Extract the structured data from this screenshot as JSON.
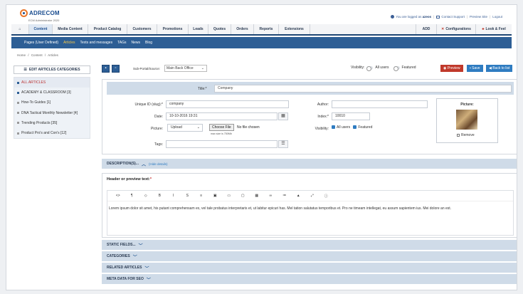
{
  "brand": {
    "name": "ADRECOM",
    "subtitle": "ECM Administrator 2020"
  },
  "top_links": {
    "logged_in_prefix": "You are logged as",
    "user": "azeos",
    "contact": "Contact Support",
    "preview_site": "Preview Site",
    "logout": "Logout"
  },
  "main_nav": {
    "home_icon": "home-icon",
    "tabs": [
      "Content",
      "Media Content",
      "Product Catalog",
      "Customers",
      "Promotions",
      "Leads",
      "Quotes",
      "Orders",
      "Reports",
      "Extensions"
    ],
    "active_tab": "Content",
    "right_tabs": [
      "ADD",
      "Configurations",
      "Look & Feel"
    ]
  },
  "sub_nav": {
    "items": [
      "Pages (User Defined)",
      "Articles",
      "Texts and messages",
      "TAGs",
      "News",
      "Blog"
    ],
    "active": "Articles"
  },
  "breadcrumb": [
    "Home",
    "/",
    "Content",
    "/",
    "Articles"
  ],
  "left_panel": {
    "edit_button": "EDIT ARTICLES CATEGORIES",
    "categories": [
      "ALL ARTICLES",
      "ACADEMY & CLASSROOM [3]",
      "How-To Guides [1]",
      "DNA Tactical Monthly Newsletter [4]",
      "Trending Products [35]",
      "Product Pro's and Con's [12]"
    ]
  },
  "toolbar": {
    "subportal_label": "Sub-Portal/Source:",
    "subportal_value": "Main Back Office",
    "visibility_label": "Visibility:",
    "all_users": "All users",
    "featured": "Featured",
    "preview": "Preview",
    "save": "Save",
    "back": "Back to list"
  },
  "form": {
    "title_label": "Title:*",
    "title_value": "Company",
    "unique_id_label": "Unique ID (slug):*",
    "unique_id_value": "company",
    "date_label": "Date:",
    "date_value": "10-10-2016 19:31",
    "picture_label": "Picture:",
    "picture_mode": "Upload",
    "choose_file": "Choose File",
    "no_file": "No file chosen",
    "max_size": "max size is 750Mb",
    "tags_label": "Tags:",
    "author_label": "Author:",
    "author_value": "",
    "index_label": "Index:*",
    "index_value": "10010",
    "visibility_label": "Visibility:",
    "vis_all_users": "All users",
    "vis_featured": "Featured",
    "picture_box_title": "Picture:",
    "remove_label": "Remove"
  },
  "description": {
    "section_title": "DESCRIPTION(S)...",
    "hide_link": "(Hide details)",
    "header_label": "Header or preview text:",
    "editor_tools": [
      "<>",
      "¶",
      "◇",
      "B",
      "I",
      "S",
      "≡",
      "▣",
      "▭",
      "▢",
      "▦",
      "∞",
      "≔",
      "▲",
      "⤢",
      "ⓘ"
    ],
    "body": "Lorem ipsum dolor sit amet, his putant comprehensam ex, vel tale probatus interpretaris et, ut labitur epicuri has. Mel tation salutatus temporibus et. Pro ne timeam intellegat, eu assum sapientem ius. Mei dolore an est."
  },
  "sections": [
    "STATIC FIELDS...",
    "CATEGORIES",
    "RELATED ARTICLES",
    "META DATA FOR SEO"
  ],
  "colors": {
    "nav_blue": "#2d5e95",
    "section_bg": "#cfdbe8",
    "preview_red": "#c0392b",
    "button_blue": "#2f7cc1"
  }
}
